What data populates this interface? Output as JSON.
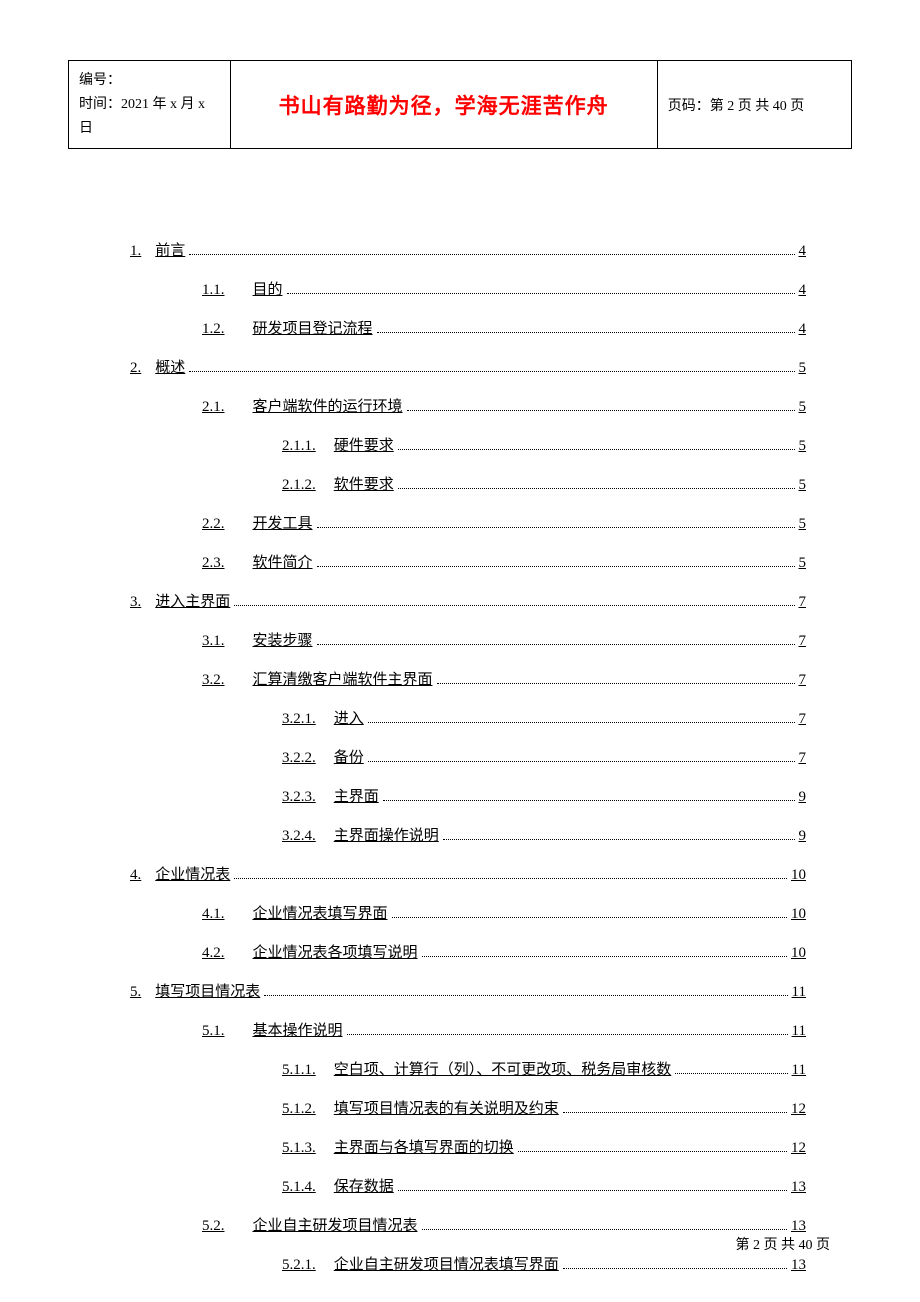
{
  "header": {
    "left_line1": "编号：",
    "left_line2": "时间：2021 年 x 月 x 日",
    "motto": "书山有路勤为径，学海无涯苦作舟",
    "right": "页码：第 2 页  共 40 页"
  },
  "toc": [
    {
      "level": 1,
      "num": "1.",
      "title": "前言",
      "page": "4"
    },
    {
      "level": 2,
      "num": "1.1.",
      "title": "目的",
      "page": "4"
    },
    {
      "level": 2,
      "num": "1.2.",
      "title": "研发项目登记流程",
      "page": "4"
    },
    {
      "level": 1,
      "num": "2.",
      "title": "概述",
      "page": "5"
    },
    {
      "level": 2,
      "num": "2.1.",
      "title": "客户端软件的运行环境",
      "page": "5"
    },
    {
      "level": 3,
      "num": "2.1.1.",
      "title": "硬件要求",
      "page": "5"
    },
    {
      "level": 3,
      "num": "2.1.2.",
      "title": "软件要求",
      "page": "5"
    },
    {
      "level": 2,
      "num": "2.2.",
      "title": "开发工具",
      "page": "5"
    },
    {
      "level": 2,
      "num": "2.3.",
      "title": "软件简介",
      "page": "5"
    },
    {
      "level": 1,
      "num": "3.",
      "title": "进入主界面",
      "page": "7"
    },
    {
      "level": 2,
      "num": "3.1.",
      "title": "安装步骤",
      "page": "7"
    },
    {
      "level": 2,
      "num": "3.2.",
      "title": "汇算清缴客户端软件主界面",
      "page": "7"
    },
    {
      "level": 3,
      "num": "3.2.1.",
      "title": "进入",
      "page": "7"
    },
    {
      "level": 3,
      "num": "3.2.2.",
      "title": "备份",
      "page": "7"
    },
    {
      "level": 3,
      "num": "3.2.3.",
      "title": "主界面",
      "page": "9"
    },
    {
      "level": 3,
      "num": "3.2.4.",
      "title": "主界面操作说明",
      "page": "9"
    },
    {
      "level": 1,
      "num": "4.",
      "title": "企业情况表",
      "page": "10"
    },
    {
      "level": 2,
      "num": "4.1.",
      "title": "企业情况表填写界面",
      "page": "10"
    },
    {
      "level": 2,
      "num": "4.2.",
      "title": "企业情况表各项填写说明",
      "page": "10"
    },
    {
      "level": 1,
      "num": "5.",
      "title": "填写项目情况表",
      "page": "11"
    },
    {
      "level": 2,
      "num": "5.1.",
      "title": "基本操作说明",
      "page": "11"
    },
    {
      "level": 3,
      "num": "5.1.1.",
      "title": "空白项、计算行（列）、不可更改项、税务局审核数",
      "page": "11"
    },
    {
      "level": 3,
      "num": "5.1.2.",
      "title": "填写项目情况表的有关说明及约束",
      "page": "12"
    },
    {
      "level": 3,
      "num": "5.1.3.",
      "title": "主界面与各填写界面的切换",
      "page": "12"
    },
    {
      "level": 3,
      "num": "5.1.4.",
      "title": "保存数据",
      "page": "13"
    },
    {
      "level": 2,
      "num": "5.2.",
      "title": "企业自主研发项目情况表",
      "page": "13"
    },
    {
      "level": 3,
      "num": "5.2.1.",
      "title": "企业自主研发项目情况表填写界面",
      "page": "13"
    }
  ],
  "footer": "第 2 页 共 40 页"
}
